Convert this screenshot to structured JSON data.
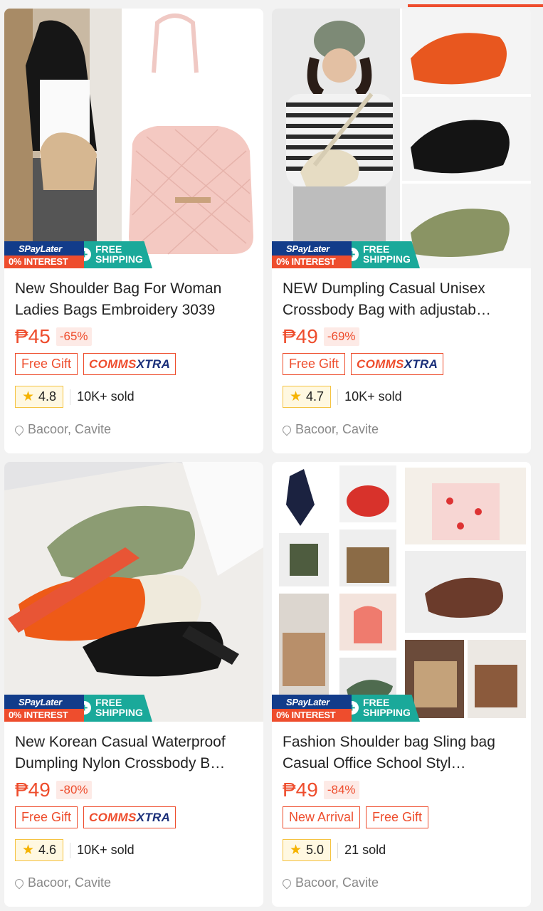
{
  "badges": {
    "spaylater": "SPayLater",
    "interest": "0% INTEREST",
    "free_shipping_1": "FREE",
    "free_shipping_2": "SHIPPING"
  },
  "products": [
    {
      "title": "New Shoulder Bag For Woman Ladies Bags Embroidery 3039",
      "price": "₱45",
      "discount": "-65%",
      "tags": [
        "Free Gift",
        "COMMSXTRA"
      ],
      "rating": "4.8",
      "sold": "10K+ sold",
      "location": "Bacoor, Cavite"
    },
    {
      "title": "NEW Dumpling Casual Unisex Crossbody Bag with adjustab…",
      "price": "₱49",
      "discount": "-69%",
      "tags": [
        "Free Gift",
        "COMMSXTRA"
      ],
      "rating": "4.7",
      "sold": "10K+ sold",
      "location": "Bacoor, Cavite"
    },
    {
      "title": "New Korean Casual Waterproof Dumpling Nylon Crossbody B…",
      "price": "₱49",
      "discount": "-80%",
      "tags": [
        "Free Gift",
        "COMMSXTRA"
      ],
      "rating": "4.6",
      "sold": "10K+ sold",
      "location": "Bacoor, Cavite"
    },
    {
      "title": "Fashion Shoulder bag Sling bag Casual Office School Styl…",
      "price": "₱49",
      "discount": "-84%",
      "tags": [
        "New Arrival",
        "Free Gift"
      ],
      "rating": "5.0",
      "sold": "21 sold",
      "location": "Bacoor, Cavite"
    }
  ],
  "colors": {
    "accent": "#ee4d2d",
    "spaylater_blue": "#123c8a",
    "shipping_teal": "#1aa99a",
    "star": "#f5b301"
  }
}
